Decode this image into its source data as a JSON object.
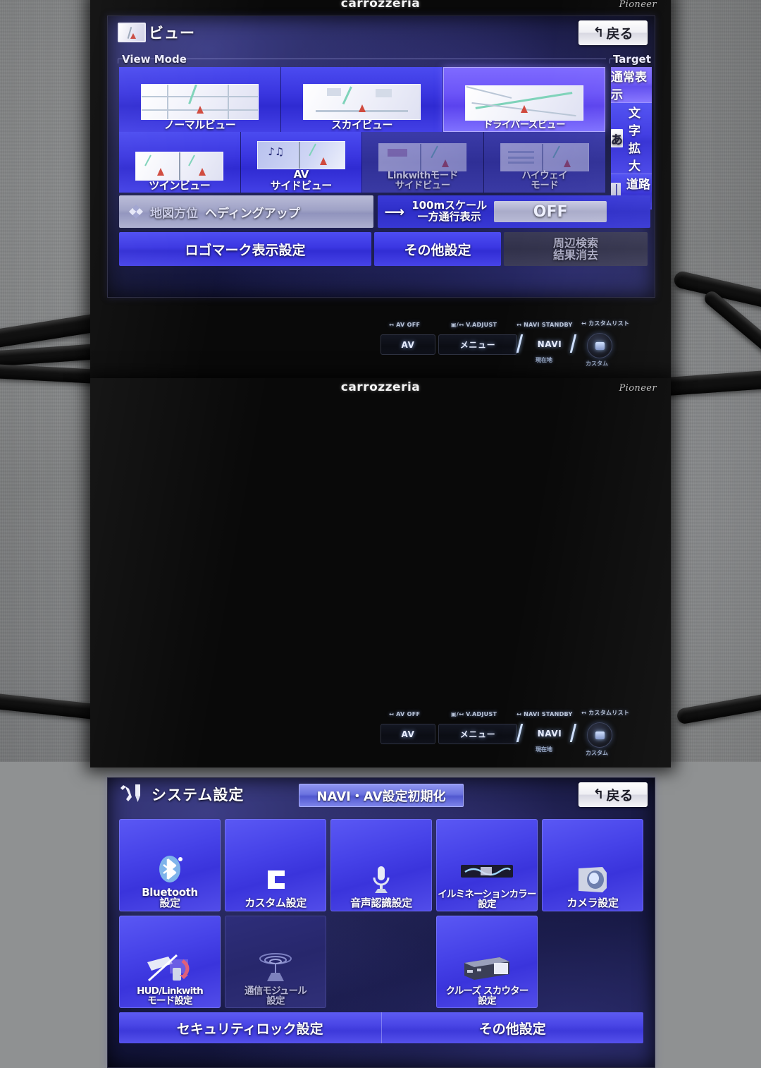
{
  "background": {
    "surface_color": "#9a9c9d",
    "cable_color": "#111111"
  },
  "unit1": {
    "brand_left": "carrozzeria",
    "brand_right": "Pioneer",
    "screen": {
      "title": "ビュー",
      "title_icon": "map-view-icon",
      "back_button": {
        "label": "戻る",
        "icon": "back-arrow-icon"
      },
      "view_mode": {
        "group_label": "View Mode",
        "buttons": [
          {
            "label": "ノーマルビュー",
            "state": "normal",
            "icon": "normal-view-thumb"
          },
          {
            "label": "スカイビュー",
            "state": "normal",
            "icon": "sky-view-thumb"
          },
          {
            "label": "ドライバーズビュー",
            "state": "selected",
            "icon": "drivers-view-thumb"
          },
          {
            "label": "ツインビュー",
            "state": "normal",
            "icon": "twin-view-thumb"
          },
          {
            "label": "AV\nサイドビュー",
            "state": "normal",
            "icon": "av-side-view-thumb"
          },
          {
            "label": "Linkwithモード\nサイドビュー",
            "state": "disabled",
            "icon": "linkwith-side-view-thumb"
          },
          {
            "label": "ハイウェイ\nモード",
            "state": "disabled",
            "icon": "highway-mode-thumb"
          }
        ]
      },
      "target_map": {
        "group_label": "Target Map",
        "buttons": [
          {
            "label": "通常表示",
            "state": "selected",
            "icon": null
          },
          {
            "label": "文字拡大",
            "state": "normal",
            "icon": "あ"
          },
          {
            "label": "道路重視",
            "state": "normal",
            "icon": "road-emphasis-icon"
          }
        ]
      },
      "middle_row": {
        "map_orientation": {
          "icon": "compass-icon",
          "label": "地図方位",
          "value": "ヘディングアップ",
          "state": "disabled"
        },
        "scale_oneway": {
          "icon": "arrow-right-icon",
          "label_line1": "100mスケール",
          "label_line2": "一方通行表示",
          "value": "OFF"
        }
      },
      "bottom_row": [
        {
          "label": "ロゴマーク表示設定",
          "state": "normal"
        },
        {
          "label": "その他設定",
          "state": "normal"
        },
        {
          "label": "周辺検索\n結果消去",
          "state": "disabled"
        }
      ]
    },
    "hardware": {
      "labels": [
        "AV OFF",
        "/ V.ADJUST",
        "NAVI STANDBY",
        "カスタムリスト"
      ],
      "keys": [
        "AV",
        "メニュー",
        "NAVI"
      ],
      "sub_labels": [
        "現在地",
        "カスタム"
      ],
      "dial_icon": "custom-dial-icon"
    }
  },
  "unit2": {
    "brand_left": "carrozzeria",
    "brand_right": "Pioneer",
    "screen": {
      "title": "システム設定",
      "title_icon": "wrench-screwdriver-icon",
      "reset_button": {
        "label": "NAVI・AV設定初期化"
      },
      "back_button": {
        "label": "戻る",
        "icon": "back-arrow-icon"
      },
      "tiles": [
        {
          "label": "Bluetooth\n設定",
          "state": "normal",
          "icon": "bluetooth-icon"
        },
        {
          "label": "カスタム設定",
          "state": "normal",
          "icon": "custom-c-icon"
        },
        {
          "label": "音声認識設定",
          "state": "normal",
          "icon": "microphone-icon"
        },
        {
          "label": "イルミネーションカラー\n設定",
          "state": "normal",
          "icon": "illumination-color-icon"
        },
        {
          "label": "カメラ設定",
          "state": "normal",
          "icon": "camera-icon"
        },
        {
          "label": "HUD/Linkwith\nモード設定",
          "state": "normal",
          "icon": "hud-linkwith-icon"
        },
        {
          "label": "通信モジュール\n設定",
          "state": "disabled",
          "icon": "comm-module-icon"
        },
        {
          "label": "",
          "state": "empty",
          "icon": null
        },
        {
          "label": "クルーズ スカウター\n設定",
          "state": "normal",
          "icon": "cruise-scouter-icon"
        },
        {
          "label": "",
          "state": "empty",
          "icon": null
        }
      ],
      "bottom_bar": [
        {
          "label": "セキュリティロック設定"
        },
        {
          "label": "その他設定"
        }
      ]
    },
    "hardware": {
      "labels": [
        "AV OFF",
        "/ V.ADJUST",
        "NAVI STANDBY",
        "カスタムリスト"
      ],
      "keys": [
        "AV",
        "メニュー",
        "NAVI"
      ],
      "sub_labels": [
        "現在地",
        "カスタム"
      ],
      "dial_icon": "custom-dial-icon"
    }
  }
}
